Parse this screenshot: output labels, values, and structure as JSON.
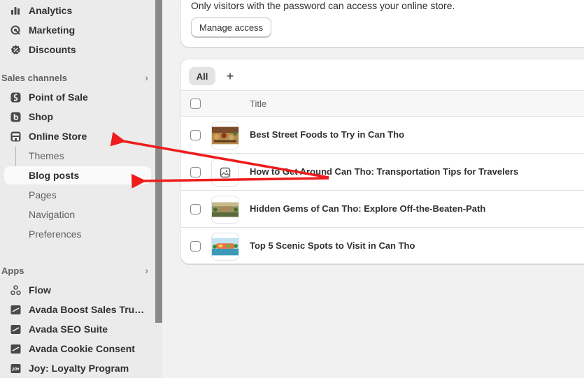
{
  "sidebar": {
    "top_items": [
      {
        "label": "Analytics",
        "icon": "bar-chart-icon"
      },
      {
        "label": "Marketing",
        "icon": "target-icon"
      },
      {
        "label": "Discounts",
        "icon": "discount-icon"
      }
    ],
    "sales_channels": {
      "heading": "Sales channels",
      "items": [
        {
          "label": "Point of Sale",
          "icon": "pos-icon"
        },
        {
          "label": "Shop",
          "icon": "shop-icon"
        },
        {
          "label": "Online Store",
          "icon": "store-icon"
        }
      ],
      "sub_items": [
        "Themes",
        "Blog posts",
        "Pages",
        "Navigation",
        "Preferences"
      ],
      "active_sub": "Blog posts"
    },
    "apps": {
      "heading": "Apps",
      "items": [
        {
          "label": "Flow",
          "icon": "flow-icon"
        },
        {
          "label": "Avada Boost Sales Trust ...",
          "icon": "avada-icon"
        },
        {
          "label": "Avada SEO Suite",
          "icon": "avada-icon"
        },
        {
          "label": "Avada Cookie Consent",
          "icon": "avada-icon"
        },
        {
          "label": "Joy: Loyalty Program",
          "icon": "joy-icon"
        }
      ]
    }
  },
  "main": {
    "password_notice": "Only visitors with the password can access your online store.",
    "manage_access_label": "Manage access",
    "tabs": {
      "all_label": "All",
      "add_label": "+"
    },
    "table": {
      "column_title": "Title",
      "rows": [
        {
          "title": "Best Street Foods to Try in Can Tho",
          "thumb": "street-food-thumbnail"
        },
        {
          "title": "How to Get Around Can Tho: Transportation Tips for Travelers",
          "thumb": "image-placeholder-icon"
        },
        {
          "title": "Hidden Gems of Can Tho: Explore Off-the-Beaten-Path",
          "thumb": "hidden-gems-thumbnail"
        },
        {
          "title": "Top 5 Scenic Spots to Visit in Can Tho",
          "thumb": "scenic-spots-thumbnail"
        }
      ]
    }
  },
  "annotation_color": "#ee1c1c"
}
